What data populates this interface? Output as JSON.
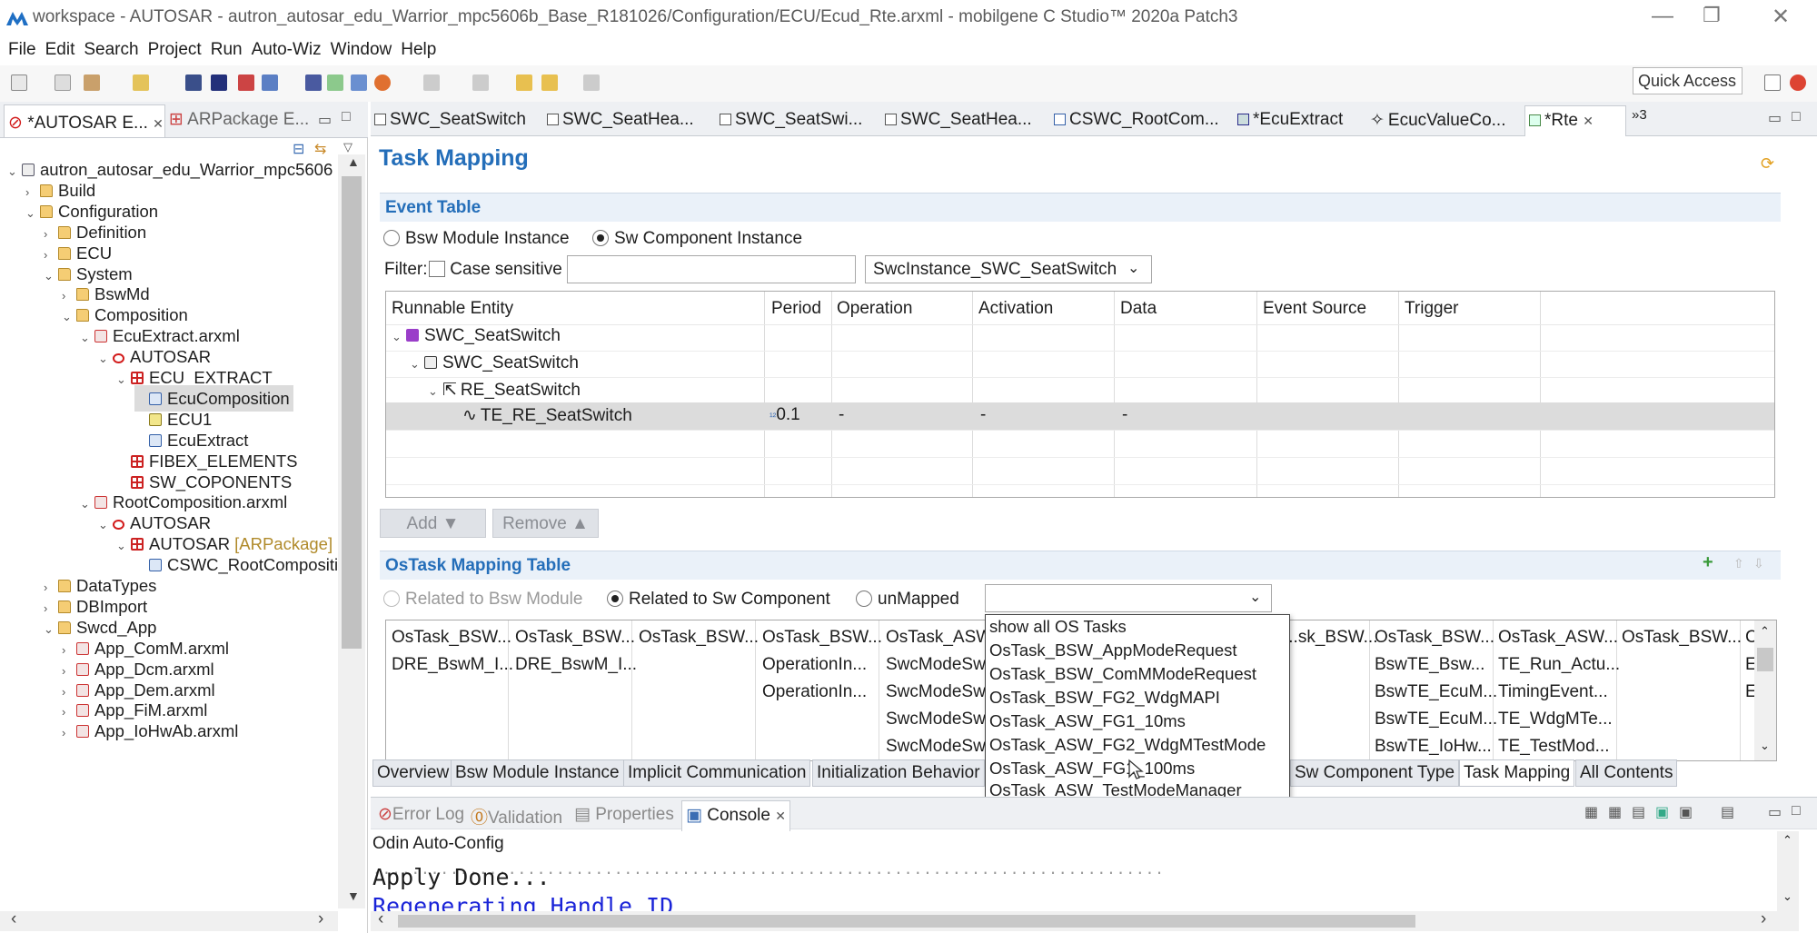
{
  "window": {
    "title": "workspace - AUTOSAR - autron_autosar_edu_Warrior_mpc5606b_Base_R181026/Configuration/ECU/Ecud_Rte.arxml - mobilgene C Studio™ 2020a Patch3"
  },
  "menu": [
    "File",
    "Edit",
    "Search",
    "Project",
    "Run",
    "Auto-Wiz",
    "Window",
    "Help"
  ],
  "quick_access": "Quick Access",
  "left_tabs": {
    "explorer": "*AUTOSAR E...",
    "package": "ARPackage E..."
  },
  "tree": [
    {
      "label": "autron_autosar_edu_Warrior_mpc5606"
    },
    {
      "label": "Build"
    },
    {
      "label": "Configuration"
    },
    {
      "label": "Definition"
    },
    {
      "label": "ECU"
    },
    {
      "label": "System"
    },
    {
      "label": "BswMd"
    },
    {
      "label": "Composition"
    },
    {
      "label": "EcuExtract.arxml"
    },
    {
      "label": "AUTOSAR"
    },
    {
      "label": "ECU_EXTRACT"
    },
    {
      "label": "EcuComposition"
    },
    {
      "label": "ECU1"
    },
    {
      "label": "EcuExtract"
    },
    {
      "label": "FIBEX_ELEMENTS"
    },
    {
      "label": "SW_COPONENTS"
    },
    {
      "label": "RootComposition.arxml"
    },
    {
      "label": "AUTOSAR"
    },
    {
      "label": "AUTOSAR",
      "suffix": "[ARPackage]"
    },
    {
      "label": "CSWC_RootCompositi"
    },
    {
      "label": "DataTypes"
    },
    {
      "label": "DBImport"
    },
    {
      "label": "Swcd_App"
    },
    {
      "label": "App_ComM.arxml"
    },
    {
      "label": "App_Dcm.arxml"
    },
    {
      "label": "App_Dem.arxml"
    },
    {
      "label": "App_FiM.arxml"
    },
    {
      "label": "App_IoHwAb.arxml"
    }
  ],
  "editor_tabs": [
    "SWC_SeatSwitch",
    "SWC_SeatHea...",
    "SWC_SeatSwi...",
    "SWC_SeatHea...",
    "CSWC_RootCom...",
    "*EcuExtract",
    "EcucValueCo...",
    "*Rte"
  ],
  "editor_tabs_overflow": "»3",
  "page": {
    "title": "Task Mapping"
  },
  "event_table": {
    "title": "Event Table",
    "radio_bsw": "Bsw Module Instance",
    "radio_swc": "Sw Component Instance",
    "filter_label": "Filter:",
    "case_sensitive": "Case sensitive",
    "instance_select": "SwcInstance_SWC_SeatSwitch",
    "columns": [
      "Runnable Entity",
      "Period",
      "Operation",
      "Activation",
      "Data",
      "Event Source",
      "Trigger"
    ],
    "rows": [
      {
        "entity": "SWC_SeatSwitch"
      },
      {
        "entity": "SWC_SeatSwitch"
      },
      {
        "entity": "RE_SeatSwitch"
      },
      {
        "entity": "TE_RE_SeatSwitch",
        "period": "0.1",
        "operation": "-",
        "activation": "-",
        "data": "-"
      }
    ],
    "add": "Add",
    "remove": "Remove"
  },
  "ostask_table": {
    "title": "OsTask Mapping Table",
    "radio_bsw": "Related to Bsw Module",
    "radio_swc": "Related to Sw Component",
    "radio_unmapped": "unMapped",
    "headers": [
      "OsTask_BSW...",
      "OsTask_BSW...",
      "OsTask_BSW...",
      "OsTask_BSW...",
      "OsTask_ASW...",
      "...sk_BSW...",
      "OsTask_BSW...",
      "OsTask_ASW...",
      "OsTask_BSW..."
    ],
    "rows": [
      [
        "DRE_BswM_I...",
        "DRE_BswM_I...",
        "",
        "OperationIn...",
        "SwcModeSw...",
        "",
        "BswTE_Bsw...",
        "TE_Run_Actu...",
        ""
      ],
      [
        "",
        "",
        "",
        "OperationIn...",
        "SwcModeSw...",
        "",
        "BswTE_EcuM...",
        "TimingEvent...",
        ""
      ],
      [
        "",
        "",
        "",
        "",
        "SwcModeSw...",
        "",
        "BswTE_EcuM...",
        "TE_WdgMTe...",
        ""
      ],
      [
        "",
        "",
        "",
        "",
        "SwcModeSw...",
        "",
        "BswTE_IoHw...",
        "TE_TestMod...",
        ""
      ]
    ],
    "dropdown_options": [
      "show all OS Tasks",
      "OsTask_BSW_AppModeRequest",
      "OsTask_BSW_ComMModeRequest",
      "OsTask_BSW_FG2_WdgMAPI",
      "OsTask_ASW_FG1_10ms",
      "OsTask_ASW_FG2_WdgMTestMode",
      "OsTask_ASW_FG1_100ms",
      "OsTask_ASW_TestModeManager"
    ]
  },
  "editor_bottom_tabs": [
    "Overview",
    "Bsw Module Instance",
    "Implicit Communication",
    "Initialization Behavior",
    "Sw Component Type",
    "Task Mapping",
    "All Contents"
  ],
  "console": {
    "tabs": [
      "Error Log",
      "Validation",
      "Properties",
      "Console"
    ],
    "name": "Odin Auto-Config",
    "lines": [
      "Apply Done...",
      "Regenerating Handle ID"
    ]
  },
  "colors": {
    "accent": "#246eb9",
    "selection": "#dcdcdc"
  }
}
